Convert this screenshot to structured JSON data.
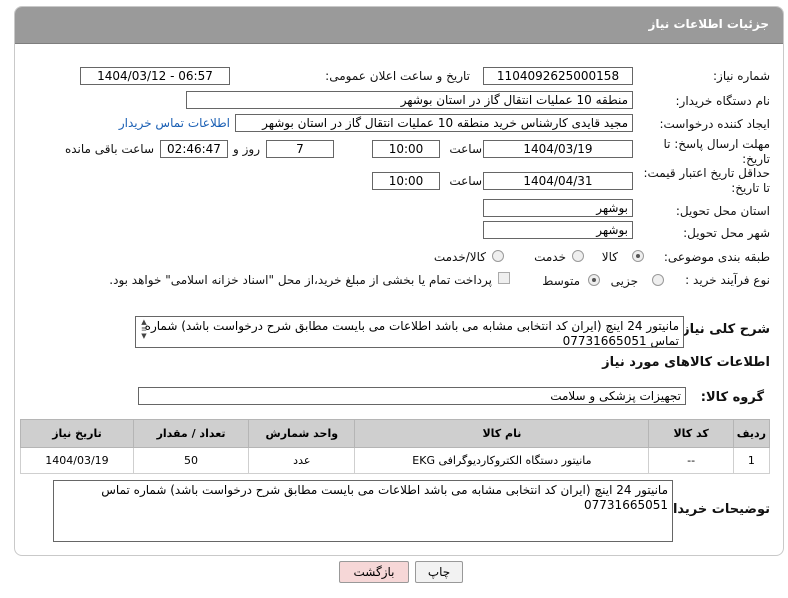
{
  "header": {
    "title": "جزئیات اطلاعات نیاز"
  },
  "labels": {
    "need_number": "شماره نیاز:",
    "announce_datetime": "تاریخ و ساعت اعلان عمومی:",
    "buyer_org": "نام دستگاه خریدار:",
    "requester": "ایجاد کننده درخواست:",
    "reply_deadline_line1": "مهلت ارسال پاسخ: تا",
    "reply_deadline_line2": "تاریخ:",
    "time": "ساعت",
    "day_and": "روز و",
    "remaining": "ساعت باقی مانده",
    "price_validity_line1": "حداقل تاریخ اعتبار قیمت:",
    "price_validity_line2": "تا تاریخ:",
    "delivery_province": "استان محل تحویل:",
    "delivery_city": "شهر محل تحویل:",
    "category": "طبقه بندی موضوعی:",
    "process_type": "نوع فرآیند خرید :",
    "description": "شرح کلی نیاز:",
    "goods_info": "اطلاعات کالاهای مورد نیاز",
    "goods_group": "گروه کالا:",
    "buyer_notes": "توضیحات خریدار:"
  },
  "values": {
    "need_number": "1104092625000158",
    "announce_datetime": "1404/03/12 - 06:57",
    "buyer_org": "منطقه 10 عملیات انتقال گاز در استان بوشهر",
    "requester": "مجید قایدی کارشناس خرید منطقه 10 عملیات انتقال گاز در استان بوشهر",
    "contact_link": "اطلاعات تماس خریدار",
    "reply_date": "1404/03/19",
    "reply_time": "10:00",
    "days": "7",
    "remaining_time": "02:46:47",
    "price_date": "1404/04/31",
    "price_time": "10:00",
    "province": "بوشهر",
    "city": "بوشهر",
    "goods_group": "تجهیزات پزشکی و سلامت"
  },
  "category_options": {
    "goods": "کالا",
    "service": "خدمت",
    "goods_service": "کالا/خدمت",
    "selected": "کالا"
  },
  "process_options": {
    "partial": "جزیی",
    "medium": "متوسط",
    "selected": "متوسط",
    "treasury_note": "پرداخت تمام یا بخشی از مبلغ خرید،از محل \"اسناد خزانه اسلامی\" خواهد بود."
  },
  "description_text": "مانیتور 24 اینچ (ایران کد انتخابی مشابه می باشد اطلاعات می بایست مطابق شرح درخواست باشد) شماره تماس 07731665051",
  "table": {
    "headers": [
      "ردیف",
      "کد کالا",
      "نام کالا",
      "واحد شمارش",
      "تعداد / مقدار",
      "تاریخ نیاز"
    ],
    "rows": [
      [
        "1",
        "--",
        "مانیتور دستگاه الکتروکاردیوگرافی EKG",
        "عدد",
        "50",
        "1404/03/19"
      ]
    ]
  },
  "buyer_notes_text": "مانیتور 24 اینچ (ایران کد انتخابی مشابه می باشد اطلاعات می بایست مطابق شرح درخواست باشد) شماره تماس 07731665051",
  "buttons": {
    "print": "چاپ",
    "back": "بازگشت"
  },
  "colors": {
    "header_bg": "#9a9a9a",
    "link": "#1a5fb4",
    "back_button_bg": "#f6d7d7",
    "watermark": "#f0c8c8"
  }
}
